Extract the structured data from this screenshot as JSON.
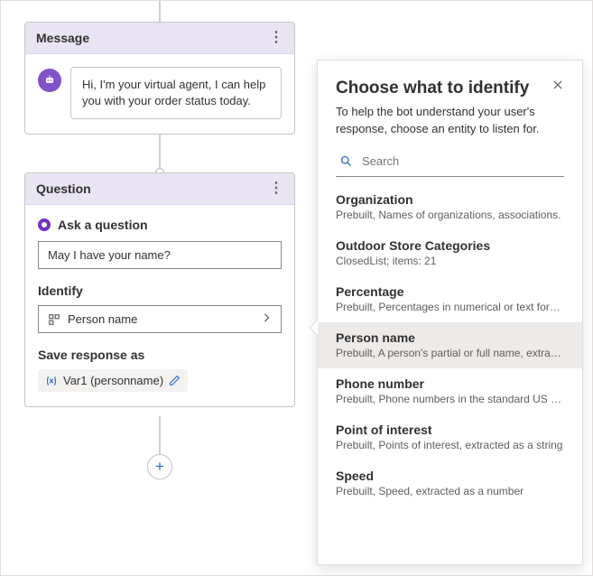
{
  "message_card": {
    "title": "Message",
    "bubble_text": "Hi, I'm your virtual agent, I can help you with your order status today."
  },
  "question_card": {
    "title": "Question",
    "ask_label": "Ask a question",
    "ask_value": "May I have your name?",
    "identify_label": "Identify",
    "identify_value": "Person name",
    "save_label": "Save response as",
    "var_chip": "Var1 (personname)"
  },
  "flyout": {
    "title": "Choose what to identify",
    "description": "To help the bot understand your user's response, choose an entity to listen for.",
    "search_placeholder": "Search",
    "options": [
      {
        "title": "Organization",
        "sub": "Prebuilt, Names of organizations, associations.",
        "selected": false
      },
      {
        "title": "Outdoor Store Categories",
        "sub": "ClosedList; items: 21",
        "selected": false
      },
      {
        "title": "Percentage",
        "sub": "Prebuilt, Percentages in numerical or text for…",
        "selected": false
      },
      {
        "title": "Person name",
        "sub": "Prebuilt, A person's partial or full name, extra…",
        "selected": true
      },
      {
        "title": "Phone number",
        "sub": "Prebuilt, Phone numbers in the standard US f…",
        "selected": false
      },
      {
        "title": "Point of interest",
        "sub": "Prebuilt, Points of interest, extracted as a string",
        "selected": false
      },
      {
        "title": "Speed",
        "sub": "Prebuilt, Speed, extracted as a number",
        "selected": false
      }
    ]
  }
}
